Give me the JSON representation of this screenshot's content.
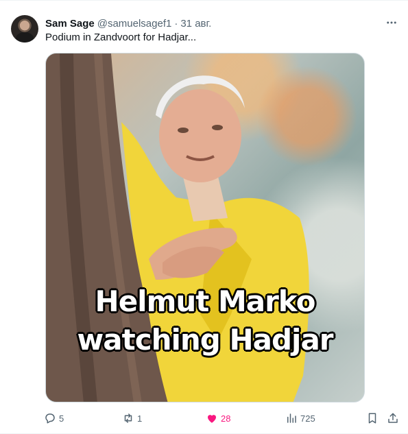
{
  "author": {
    "name": "Sam Sage",
    "handle": "@samuelsagef1",
    "separator": "·",
    "date": "31 авг."
  },
  "post": {
    "text": "Podium in Zandvoort for Hadjar...",
    "image": {
      "caption_line1": "Helmut Marko",
      "caption_line2": "watching Hadjar"
    }
  },
  "actions": {
    "replies": "5",
    "reposts": "1",
    "likes": "28",
    "views": "725"
  },
  "colors": {
    "like_active": "#f91880",
    "secondary_text": "#536471"
  },
  "icons": {
    "more": "more-dots-icon",
    "reply": "reply-icon",
    "repost": "repost-icon",
    "like": "heart-filled-icon",
    "views": "views-chart-icon",
    "bookmark": "bookmark-icon",
    "share": "share-icon"
  }
}
